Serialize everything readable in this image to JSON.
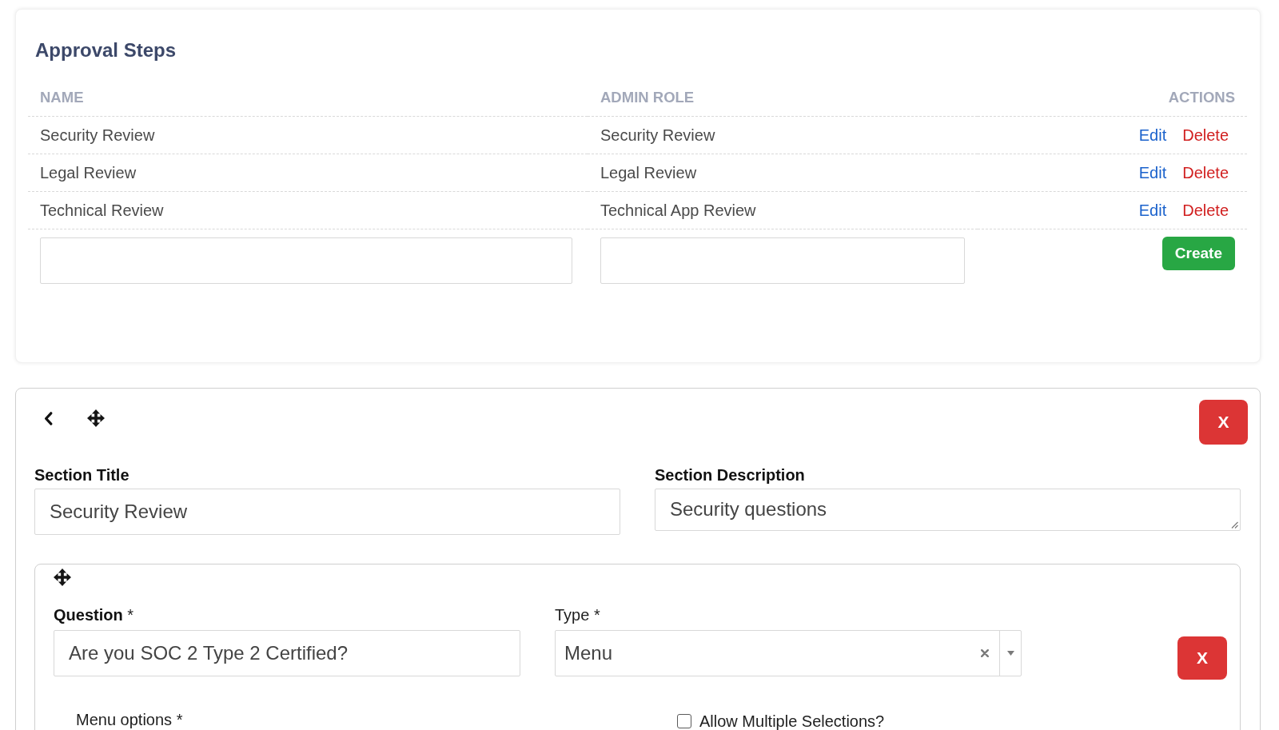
{
  "approval_steps": {
    "title": "Approval Steps",
    "columns": [
      "NAME",
      "ADMIN ROLE",
      "ACTIONS"
    ],
    "rows": [
      {
        "name": "Security Review",
        "admin_role": "Security Review",
        "actions": [
          {
            "label": "Edit",
            "kind": "edit"
          },
          {
            "label": "Delete",
            "kind": "delete"
          }
        ]
      },
      {
        "name": "Legal Review",
        "admin_role": "Legal Review",
        "actions": [
          {
            "label": "Edit",
            "kind": "edit"
          },
          {
            "label": "Delete",
            "kind": "delete"
          }
        ]
      },
      {
        "name": "Technical Review",
        "admin_role": "Technical App Review",
        "actions": [
          {
            "label": "Edit",
            "kind": "edit"
          },
          {
            "label": "Delete",
            "kind": "delete"
          }
        ]
      }
    ],
    "create_button": "Create"
  },
  "section": {
    "remove_button": "X",
    "title_label": "Section Title",
    "title_value": "Security Review",
    "description_label": "Section Description",
    "description_value": "Security questions",
    "questions": [
      {
        "label": "**Question** *",
        "value": "Are you SOC 2 Type 2 Certified?",
        "type_label": "Type *",
        "type_value": "Menu",
        "remove_button": "X",
        "menu_options_label": "Menu options *",
        "allow_multiple": {
          "label": "Allow Multiple Selections?",
          "checked": false
        }
      }
    ]
  }
}
